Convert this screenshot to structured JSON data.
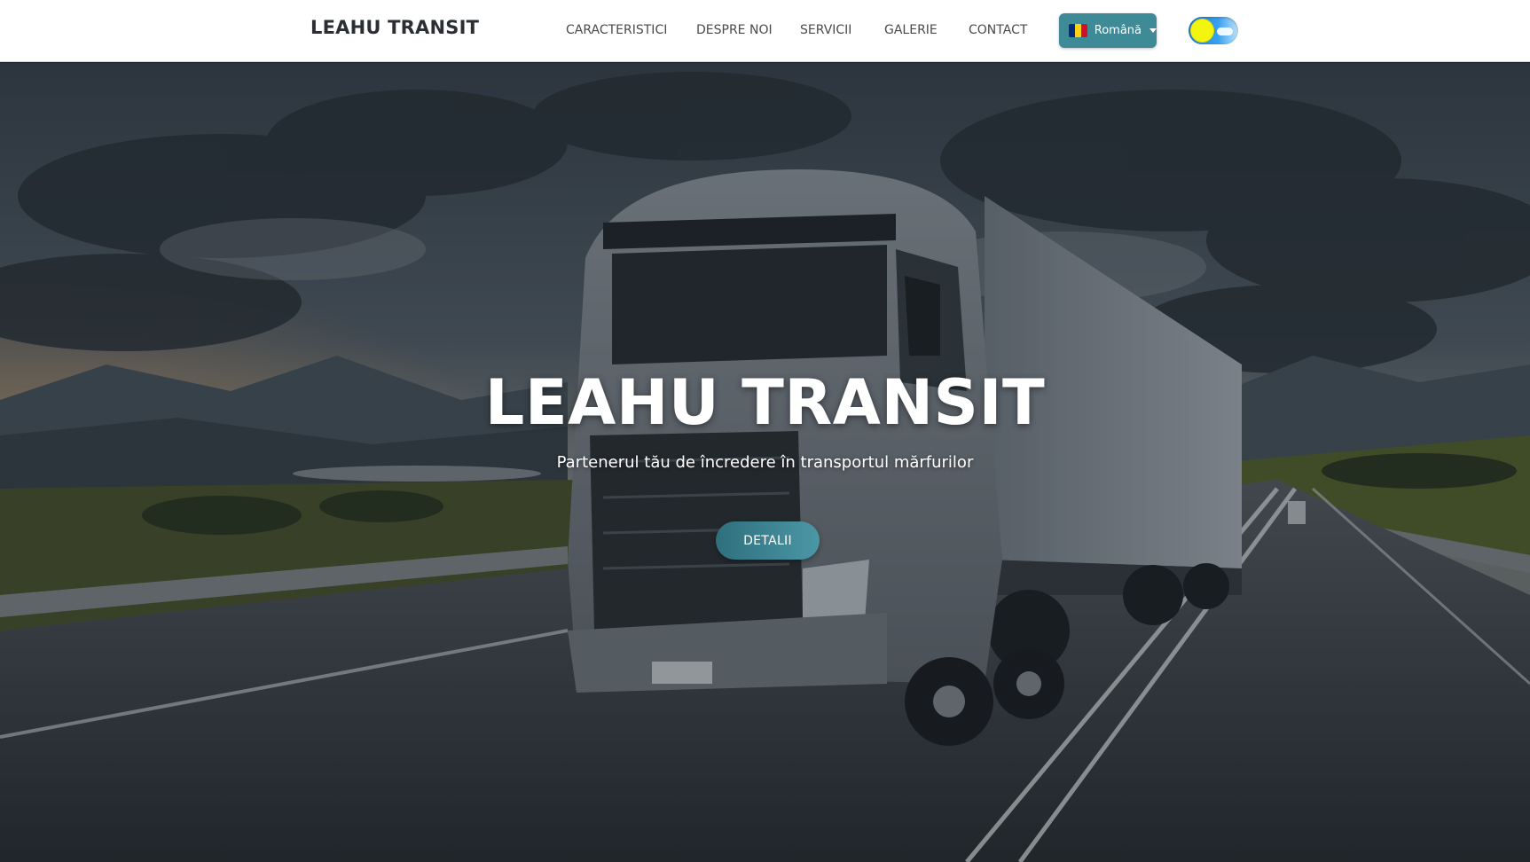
{
  "header": {
    "brand": "LEAHU TRANSIT",
    "nav": [
      {
        "label": "CARACTERISTICI"
      },
      {
        "label": "DESPRE NOI"
      },
      {
        "label": "SERVICII"
      },
      {
        "label": "GALERIE"
      },
      {
        "label": "CONTACT"
      }
    ],
    "language": {
      "label": "Română",
      "flag_colors": [
        "#002b7f",
        "#fcd116",
        "#ce1126"
      ],
      "icon": "chevron-down-icon"
    },
    "theme_toggle": {
      "state": "light",
      "icon": "sun-icon"
    }
  },
  "hero": {
    "title": "LEAHU TRANSIT",
    "subtitle": "Partenerul tău de încredere în transportul mărfurilor",
    "cta_label": "DETALII",
    "background": "truck-on-highway-image"
  },
  "colors": {
    "accent": "#3f8a97",
    "header_bg": "#ffffff",
    "nav_text": "#4a4a4a"
  }
}
